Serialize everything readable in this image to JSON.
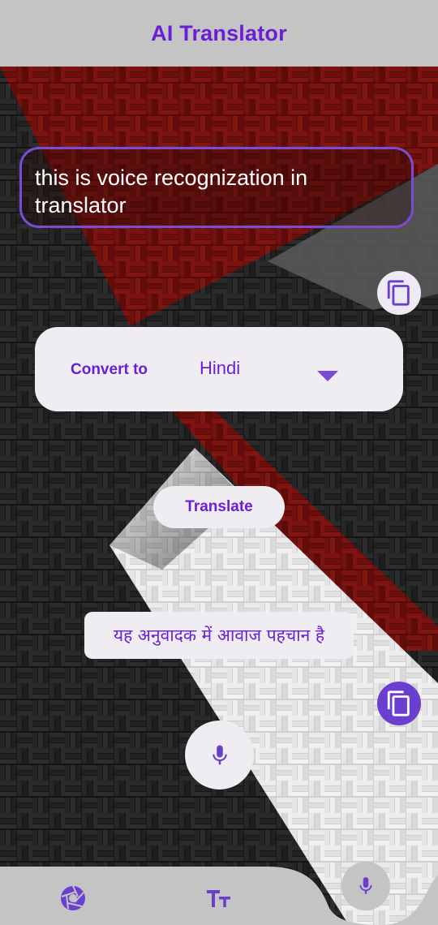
{
  "app": {
    "title": "AI Translator"
  },
  "input": {
    "text": "this is voice recognization in translator"
  },
  "convert": {
    "label": "Convert to",
    "selected_language": "Hindi"
  },
  "actions": {
    "translate_label": "Translate"
  },
  "output": {
    "text": "यह अनुवादक में आवाज पहचान है"
  },
  "icons": {
    "copy_input": "copy-icon",
    "copy_output": "copy-icon",
    "dropdown": "chevron-down-icon",
    "mic": "mic-icon",
    "nav_camera": "camera-aperture-icon",
    "nav_text": "text-size-icon",
    "nav_mic": "mic-icon"
  },
  "colors": {
    "accent": "#6a1fd6",
    "bar": "#c4c4c4",
    "card": "#efedf2",
    "copy_active": "#6a3fd0"
  },
  "bottom_nav": {
    "text_icon_label": "TT"
  }
}
